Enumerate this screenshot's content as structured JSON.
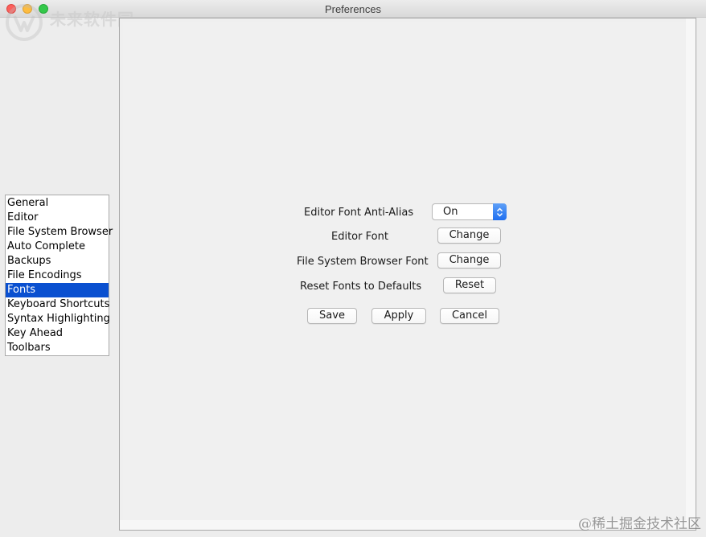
{
  "window": {
    "title": "Preferences"
  },
  "watermark": {
    "logo_icon": "watermark-logo-icon",
    "text": "未来软件园",
    "corner_text": "@稀土掘金技术社区"
  },
  "sidebar": {
    "items": [
      {
        "label": "General",
        "selected": false
      },
      {
        "label": "Editor",
        "selected": false
      },
      {
        "label": "File System Browser",
        "selected": false
      },
      {
        "label": "Auto Complete",
        "selected": false
      },
      {
        "label": "Backups",
        "selected": false
      },
      {
        "label": "File Encodings",
        "selected": false
      },
      {
        "label": "Fonts",
        "selected": true
      },
      {
        "label": "Keyboard Shortcuts",
        "selected": false
      },
      {
        "label": "Syntax Highlighting",
        "selected": false
      },
      {
        "label": "Key Ahead",
        "selected": false
      },
      {
        "label": "Toolbars",
        "selected": false
      }
    ],
    "selected_color": "#0a50d0"
  },
  "fonts_panel": {
    "anti_alias_label": "Editor Font Anti-Alias",
    "anti_alias_value": "On",
    "editor_font_label": "Editor Font",
    "editor_font_button": "Change",
    "fsb_font_label": "File System Browser Font",
    "fsb_font_button": "Change",
    "reset_label": "Reset Fonts to Defaults",
    "reset_button": "Reset"
  },
  "actions": {
    "save": "Save",
    "apply": "Apply",
    "cancel": "Cancel"
  },
  "colors": {
    "close": "#fc605c",
    "minimize": "#fdbc40",
    "zoom": "#34c84a",
    "select_accent": "#1f6ff0"
  }
}
